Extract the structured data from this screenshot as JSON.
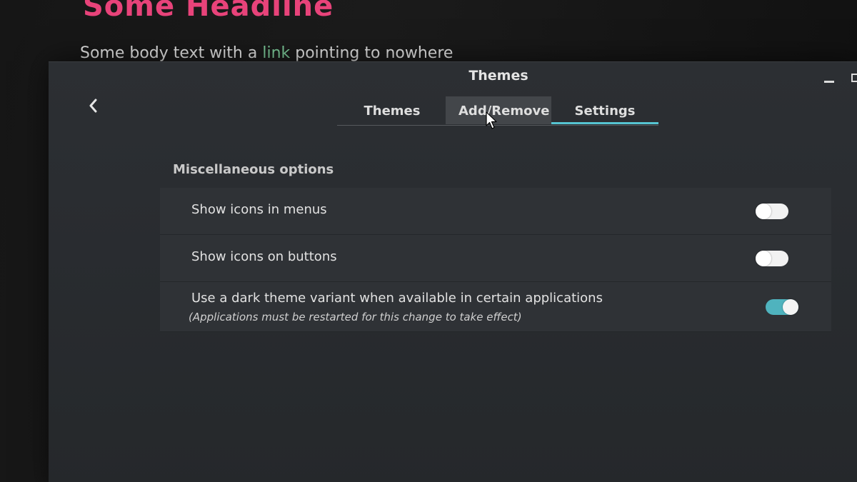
{
  "background": {
    "headline": "Some Headline",
    "body_before": "Some body text with a ",
    "body_link": "link",
    "body_after": " pointing to nowhere"
  },
  "window": {
    "title": "Themes",
    "controls": [
      "minimize-icon",
      "maximize-icon"
    ],
    "back_icon": "chevron-left-icon"
  },
  "tabs": [
    {
      "label": "Themes",
      "selected": false
    },
    {
      "label": "Add/Remove",
      "selected": false,
      "hovered": true
    },
    {
      "label": "Settings",
      "selected": true
    }
  ],
  "settings": {
    "section_title": "Miscellaneous options",
    "options": [
      {
        "label": "Show icons in menus",
        "enabled": false
      },
      {
        "label": "Show icons on buttons",
        "enabled": false
      },
      {
        "label": "Use a dark theme variant when available in certain applications",
        "note": "(Applications must be restarted for this change to take effect)",
        "enabled": true
      }
    ]
  },
  "colors": {
    "headline": "#e8437a",
    "link": "#7fcf9d",
    "accent": "#56c4d1",
    "switch_on": "#4fb3be",
    "window_bg": "#2c2f33"
  }
}
